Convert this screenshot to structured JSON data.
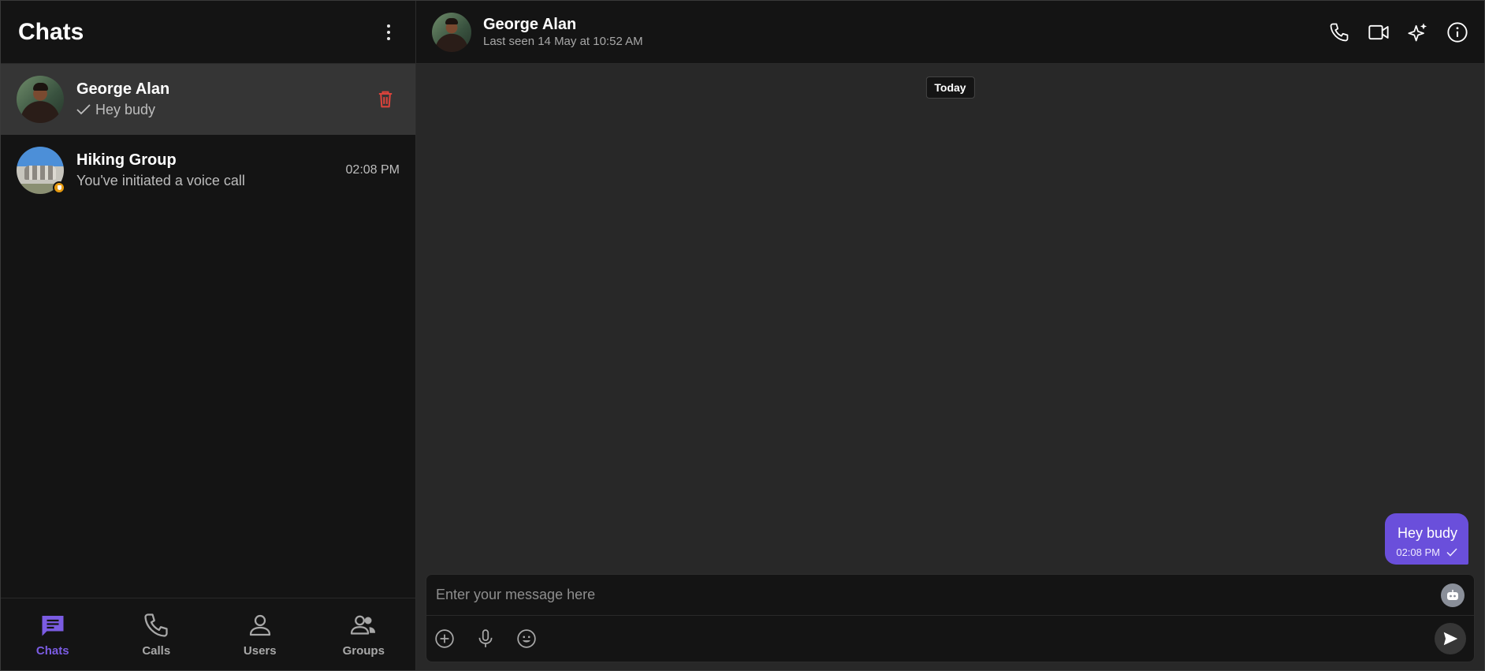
{
  "sidebar": {
    "title": "Chats",
    "menu_icon": "kebab-menu-icon",
    "chats": [
      {
        "name": "George Alan",
        "preview": "Hey budy",
        "status_icon": "check-icon",
        "action_icon": "trash-icon",
        "active": true
      },
      {
        "name": "Hiking Group",
        "preview": "You've initiated a voice call",
        "time": "02:08 PM",
        "badge_icon": "group-badge-icon",
        "active": false
      }
    ],
    "nav": [
      {
        "label": "Chats",
        "icon": "chat-bubble-icon",
        "active": true
      },
      {
        "label": "Calls",
        "icon": "phone-icon",
        "active": false
      },
      {
        "label": "Users",
        "icon": "user-icon",
        "active": false
      },
      {
        "label": "Groups",
        "icon": "group-icon",
        "active": false
      }
    ]
  },
  "conversation": {
    "name": "George Alan",
    "status": "Last seen 14 May at 10:52 AM",
    "actions": [
      "phone-icon",
      "video-icon",
      "sparkle-icon",
      "info-icon"
    ],
    "date_divider": "Today",
    "messages": [
      {
        "text": "Hey budy",
        "time": "02:08 PM",
        "status_icon": "check-icon",
        "outgoing": true
      }
    ],
    "composer": {
      "placeholder": "Enter your message here",
      "tools": [
        "add-icon",
        "microphone-icon",
        "emoji-icon"
      ],
      "bot_icon": "bot-icon",
      "send_icon": "send-icon"
    }
  },
  "colors": {
    "accent": "#6a4fdb",
    "nav_active": "#7b5ce3",
    "danger": "#d9433b",
    "background": "#141414",
    "panel": "#282828"
  }
}
